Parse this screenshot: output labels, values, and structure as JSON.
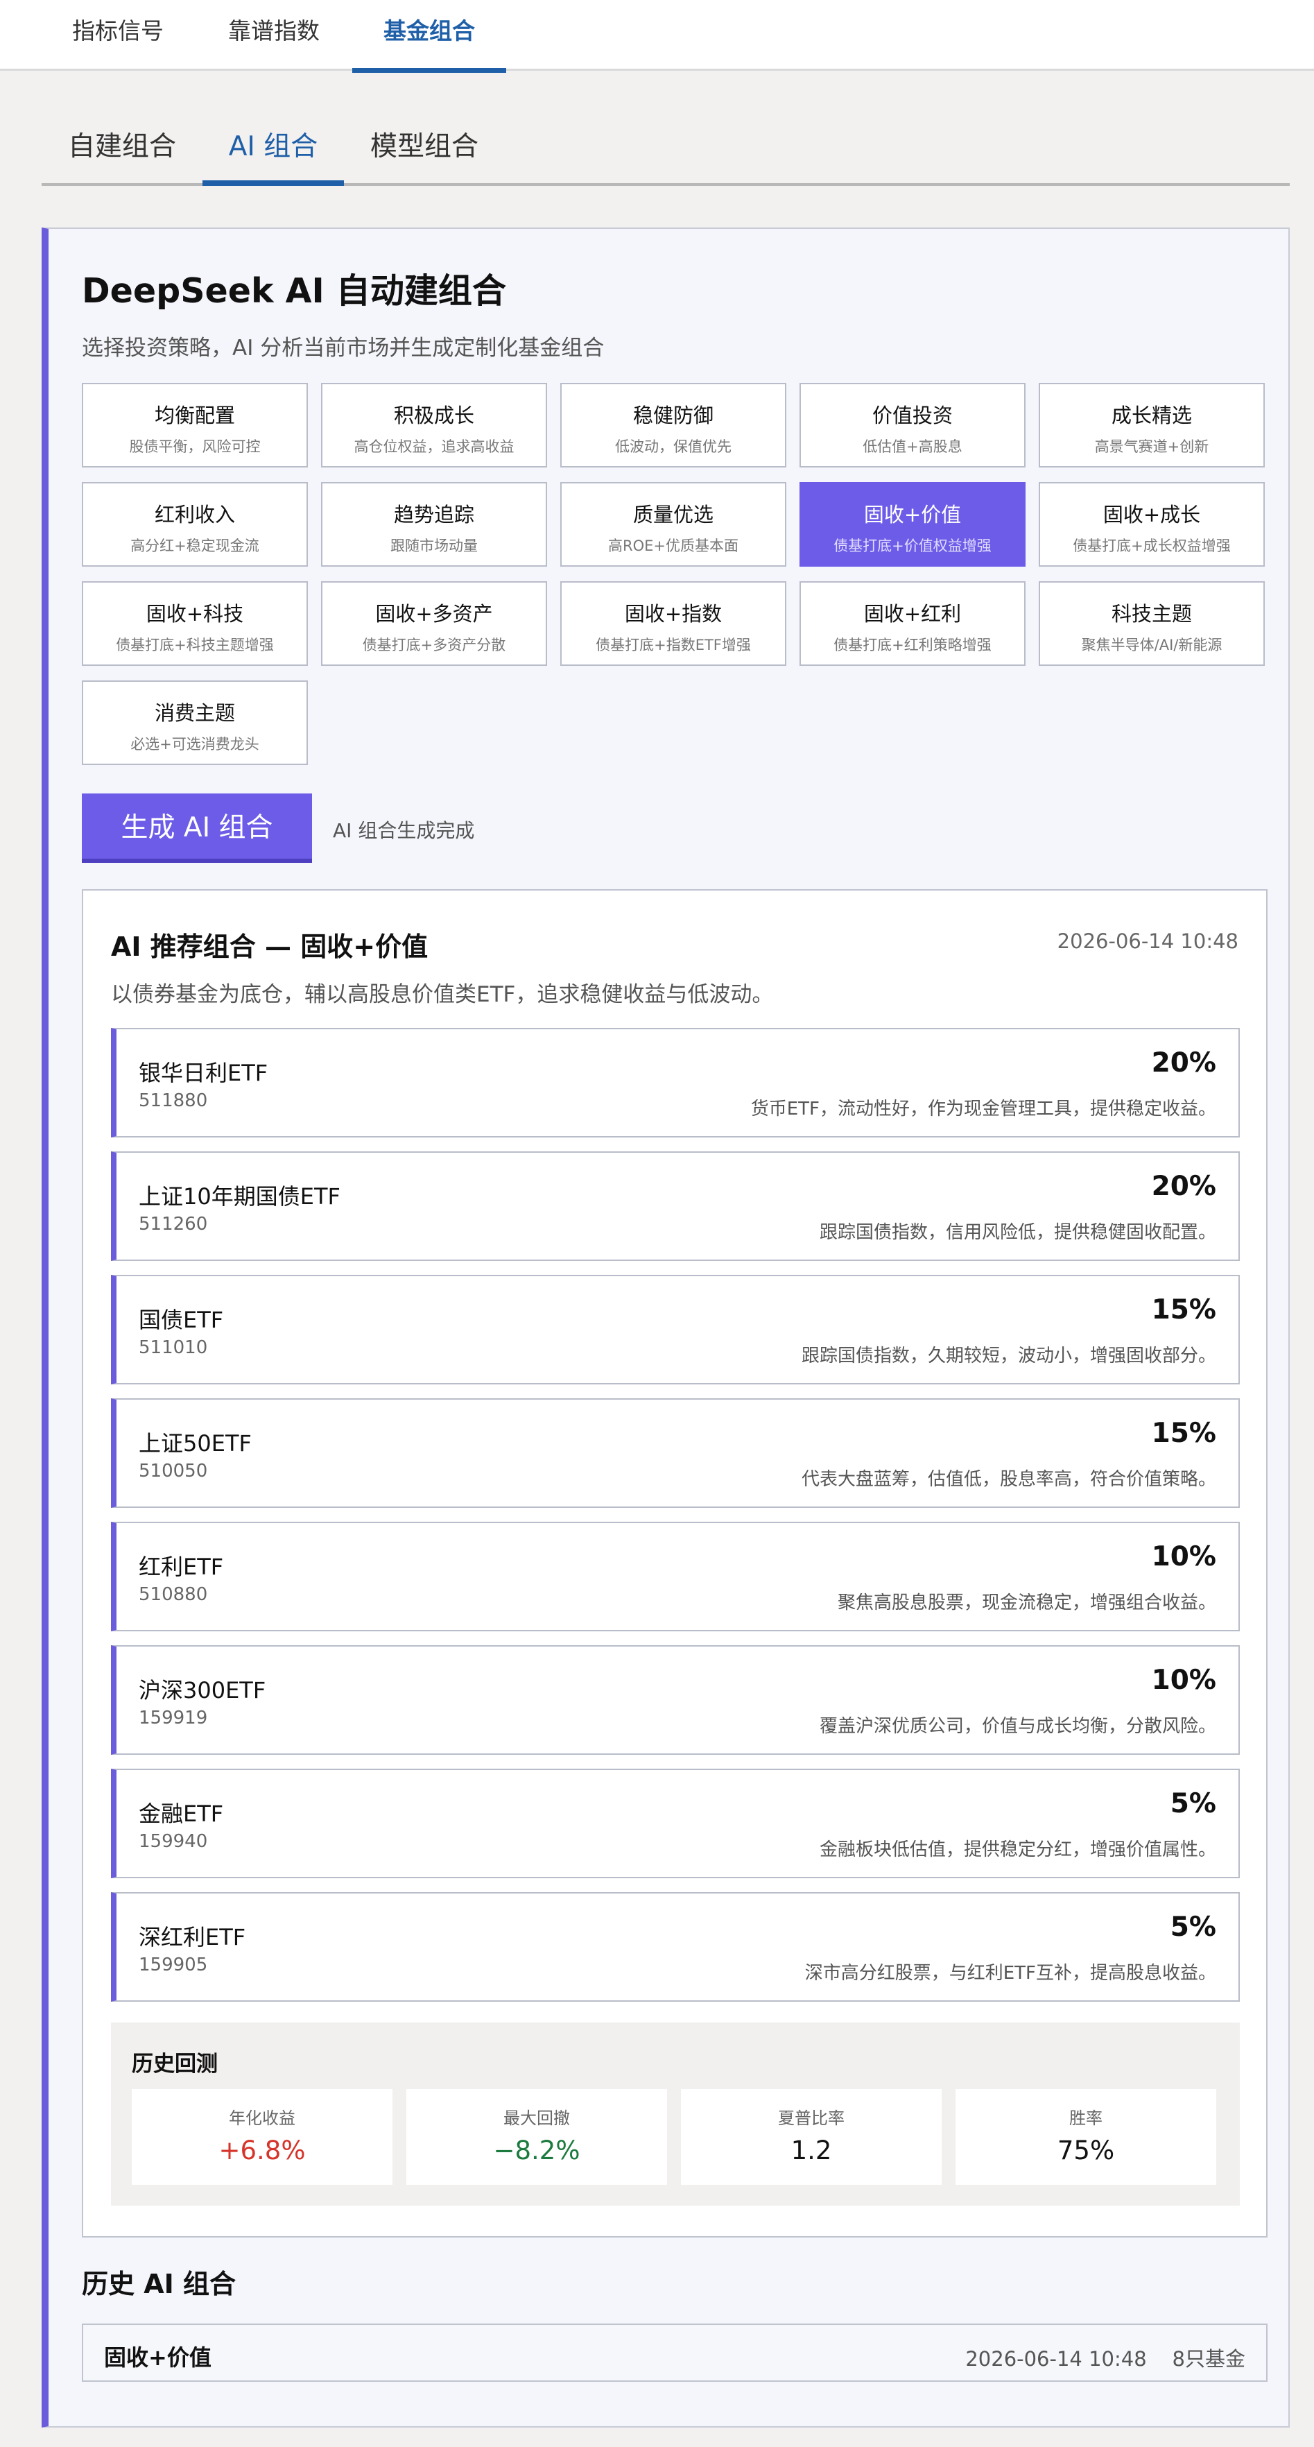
{
  "top_tabs": [
    {
      "label": "指标信号",
      "active": false
    },
    {
      "label": "靠谱指数",
      "active": false
    },
    {
      "label": "基金组合",
      "active": true
    }
  ],
  "sub_tabs": [
    {
      "label": "自建组合",
      "active": false
    },
    {
      "label": "AI 组合",
      "active": true
    },
    {
      "label": "模型组合",
      "active": false
    }
  ],
  "panel": {
    "title": "DeepSeek AI 自动建组合",
    "description": "选择投资策略，AI 分析当前市场并生成定制化基金组合",
    "strategies": [
      {
        "name": "均衡配置",
        "sub": "股债平衡，风险可控"
      },
      {
        "name": "积极成长",
        "sub": "高仓位权益，追求高收益"
      },
      {
        "name": "稳健防御",
        "sub": "低波动，保值优先"
      },
      {
        "name": "价值投资",
        "sub": "低估值+高股息"
      },
      {
        "name": "成长精选",
        "sub": "高景气赛道+创新"
      },
      {
        "name": "红利收入",
        "sub": "高分红+稳定现金流"
      },
      {
        "name": "趋势追踪",
        "sub": "跟随市场动量"
      },
      {
        "name": "质量优选",
        "sub": "高ROE+优质基本面"
      },
      {
        "name": "固收+价值",
        "sub": "债基打底+价值权益增强",
        "selected": true
      },
      {
        "name": "固收+成长",
        "sub": "债基打底+成长权益增强"
      },
      {
        "name": "固收+科技",
        "sub": "债基打底+科技主题增强"
      },
      {
        "name": "固收+多资产",
        "sub": "债基打底+多资产分散"
      },
      {
        "name": "固收+指数",
        "sub": "债基打底+指数ETF增强"
      },
      {
        "name": "固收+红利",
        "sub": "债基打底+红利策略增强"
      },
      {
        "name": "科技主题",
        "sub": "聚焦半导体/AI/新能源"
      },
      {
        "name": "消费主题",
        "sub": "必选+可选消费龙头"
      }
    ],
    "generate_button": "生成 AI 组合",
    "generate_status": "AI 组合生成完成"
  },
  "result": {
    "title": "AI 推荐组合 — 固收+价值",
    "timestamp": "2026-06-14 10:48",
    "description": "以债券基金为底仓，辅以高股息价值类ETF，追求稳健收益与低波动。",
    "funds": [
      {
        "name": "银华日利ETF",
        "code": "511880",
        "weight": "20%",
        "note": "货币ETF，流动性好，作为现金管理工具，提供稳定收益。"
      },
      {
        "name": "上证10年期国债ETF",
        "code": "511260",
        "weight": "20%",
        "note": "跟踪国债指数，信用风险低，提供稳健固收配置。"
      },
      {
        "name": "国债ETF",
        "code": "511010",
        "weight": "15%",
        "note": "跟踪国债指数，久期较短，波动小，增强固收部分。"
      },
      {
        "name": "上证50ETF",
        "code": "510050",
        "weight": "15%",
        "note": "代表大盘蓝筹，估值低，股息率高，符合价值策略。"
      },
      {
        "name": "红利ETF",
        "code": "510880",
        "weight": "10%",
        "note": "聚焦高股息股票，现金流稳定，增强组合收益。"
      },
      {
        "name": "沪深300ETF",
        "code": "159919",
        "weight": "10%",
        "note": "覆盖沪深优质公司，价值与成长均衡，分散风险。"
      },
      {
        "name": "金融ETF",
        "code": "159940",
        "weight": "5%",
        "note": "金融板块低估值，提供稳定分红，增强价值属性。"
      },
      {
        "name": "深红利ETF",
        "code": "159905",
        "weight": "5%",
        "note": "深市高分红股票，与红利ETF互补，提高股息收益。"
      }
    ],
    "backtest": {
      "title": "历史回测",
      "metrics": [
        {
          "label": "年化收益",
          "value": "+6.8%",
          "tone": "pos"
        },
        {
          "label": "最大回撤",
          "value": "−8.2%",
          "tone": "neg"
        },
        {
          "label": "夏普比率",
          "value": "1.2",
          "tone": ""
        },
        {
          "label": "胜率",
          "value": "75%",
          "tone": ""
        }
      ]
    }
  },
  "history": {
    "title": "历史 AI 组合",
    "items": [
      {
        "name": "固收+价值",
        "meta": "2026-06-14 10:48    8只基金"
      }
    ]
  },
  "colors": {
    "accent": "#6c5ce7",
    "tab_active": "#1f5fa8",
    "positive": "#d6342a",
    "negative": "#1c7a3e"
  }
}
